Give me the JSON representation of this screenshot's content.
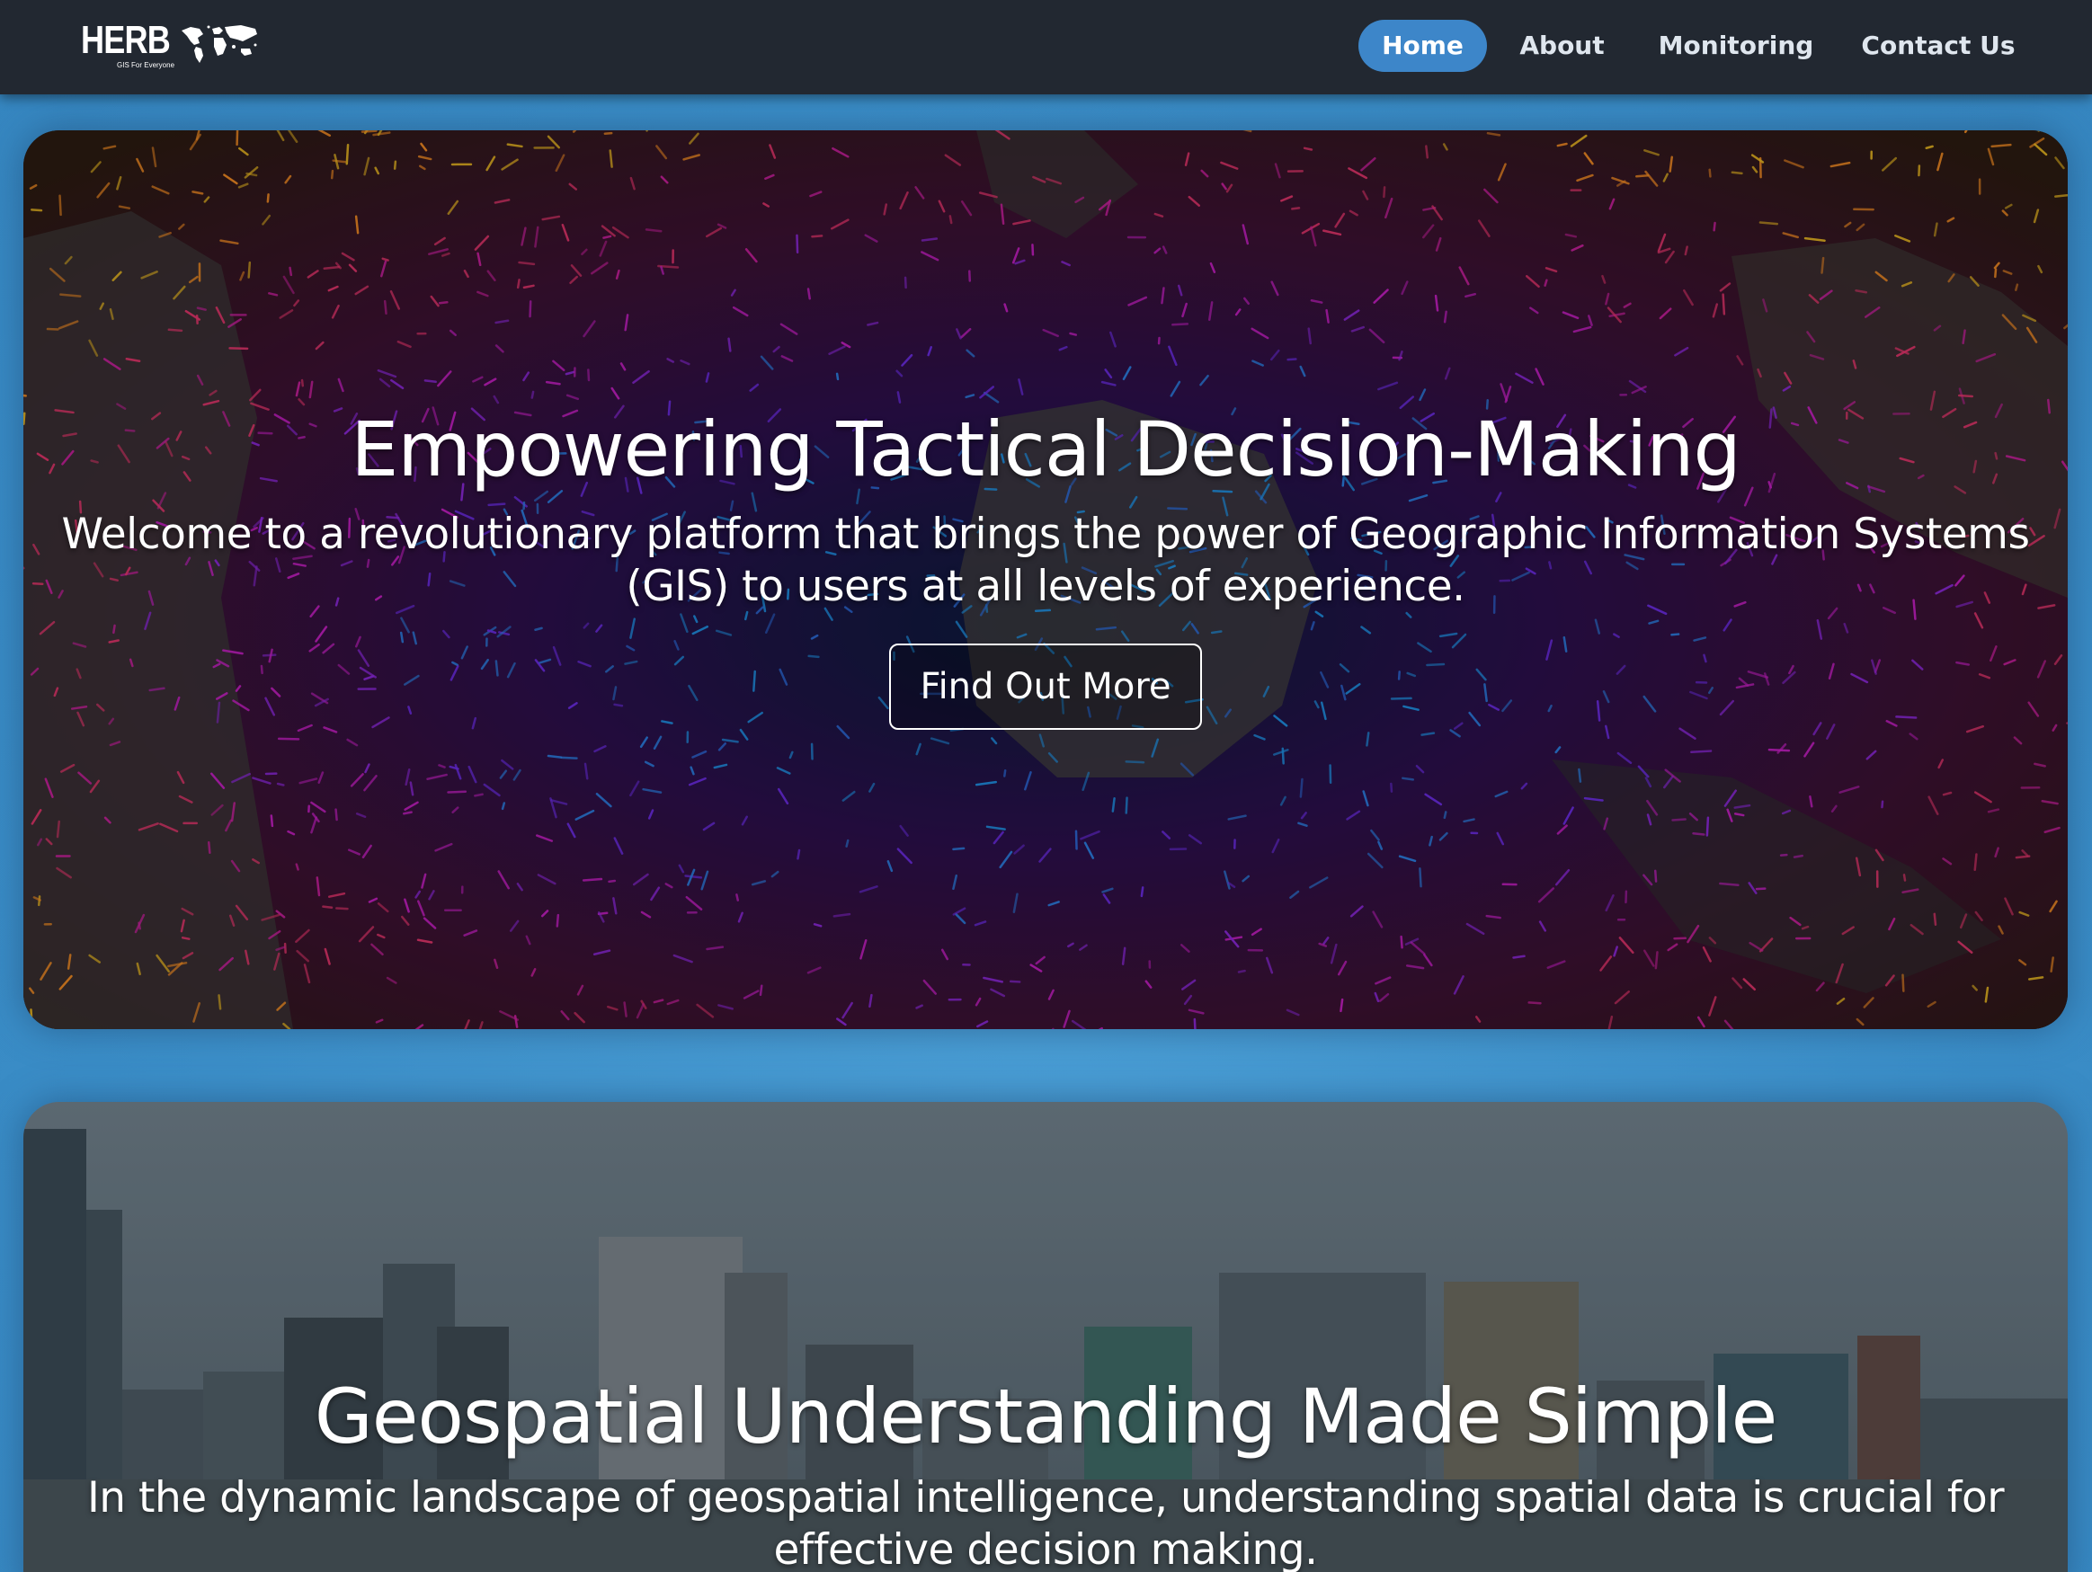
{
  "brand": {
    "name": "HERB",
    "tagline": "GIS For Everyone"
  },
  "nav": {
    "items": [
      {
        "label": "Home",
        "active": true
      },
      {
        "label": "About",
        "active": false
      },
      {
        "label": "Monitoring",
        "active": false
      },
      {
        "label": "Contact Us",
        "active": false
      }
    ]
  },
  "hero1": {
    "title": "Empowering Tactical Decision-Making",
    "subtitle": "Welcome to a revolutionary platform that brings the power of Geographic Information Systems (GIS) to users at all levels of experience.",
    "button_label": "Find Out More"
  },
  "hero2": {
    "title": "Geospatial Understanding Made Simple",
    "subtitle": "In the dynamic landscape of geospatial intelligence, understanding spatial data is crucial for effective decision making."
  },
  "colors": {
    "navbar": "#222831",
    "accent": "#3d86c9",
    "page_background": "#3b8ec8"
  },
  "icons": {
    "brand_map": "world-map-icon"
  }
}
